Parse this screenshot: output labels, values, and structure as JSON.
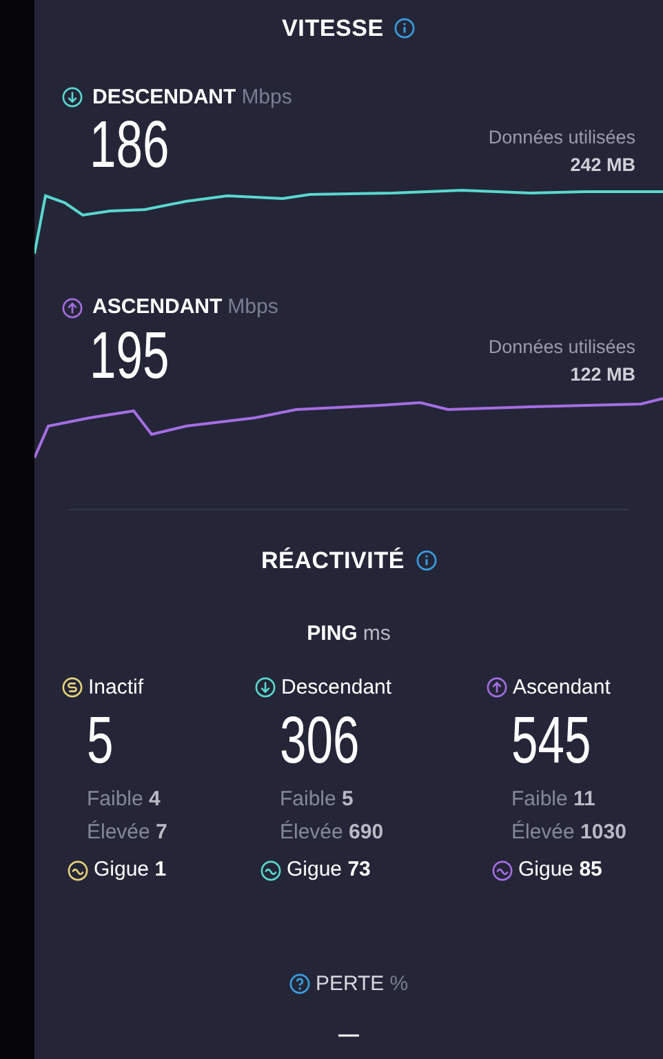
{
  "speed": {
    "title": "VITESSE",
    "tests": [
      {
        "kind": "download",
        "label": "DESCENDANT",
        "unit": "Mbps",
        "value": "186",
        "data_label": "Données utilisées",
        "data_amount": "242 MB",
        "color": "#5ad8cf"
      },
      {
        "kind": "upload",
        "label": "ASCENDANT",
        "unit": "Mbps",
        "value": "195",
        "data_label": "Données utilisées",
        "data_amount": "122 MB",
        "color": "#a56ee3"
      }
    ]
  },
  "responsiveness": {
    "title": "RÉACTIVITÉ",
    "ping": {
      "label": "PING",
      "unit": "ms",
      "columns": [
        {
          "kind": "idle",
          "label": "Inactif",
          "value": "5",
          "low_label": "Faible",
          "low": "4",
          "high_label": "Élevée",
          "high": "7",
          "jitter_label": "Gigue",
          "jitter": "1",
          "color": "#e6d27a"
        },
        {
          "kind": "download",
          "label": "Descendant",
          "value": "306",
          "low_label": "Faible",
          "low": "5",
          "high_label": "Élevée",
          "high": "690",
          "jitter_label": "Gigue",
          "jitter": "73",
          "color": "#5ad8cf"
        },
        {
          "kind": "upload",
          "label": "Ascendant",
          "value": "545",
          "low_label": "Faible",
          "low": "11",
          "high_label": "Élevée",
          "high": "1030",
          "jitter_label": "Gigue",
          "jitter": "85",
          "color": "#a56ee3"
        }
      ]
    }
  },
  "loss": {
    "label": "PERTE",
    "unit": "%",
    "value": "—"
  }
}
